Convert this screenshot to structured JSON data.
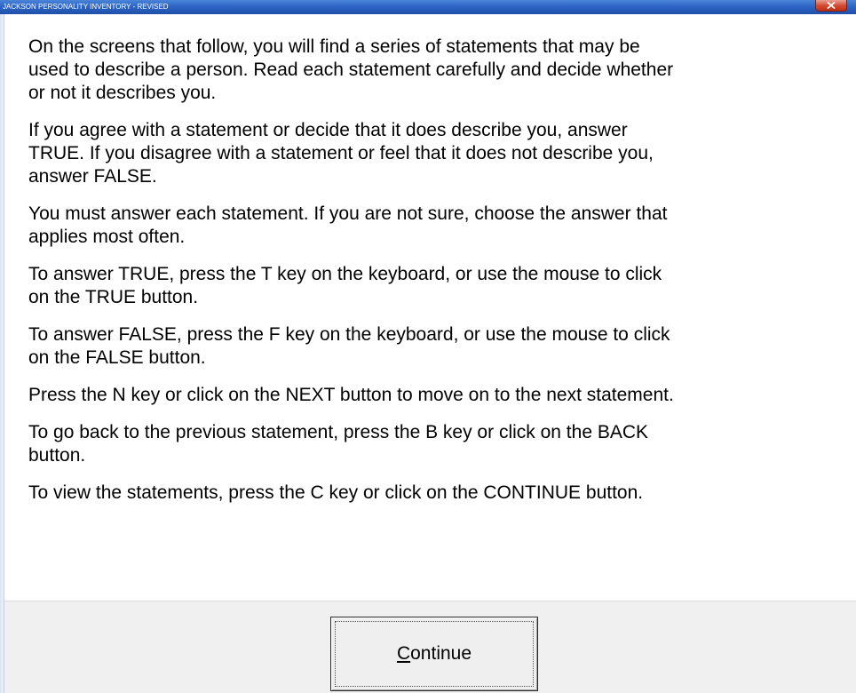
{
  "window": {
    "title": "JACKSON PERSONALITY INVENTORY - REVISED",
    "close_icon": "close-x-icon"
  },
  "instructions": [
    "On the screens that follow, you will find a series of statements that may be\nused to describe a person. Read each statement carefully and decide whether\nor not it describes you.",
    "If you agree with a statement or decide that it does describe you, answer\nTRUE. If you disagree with a statement or feel that it does not describe you,\nanswer FALSE.",
    "You must answer each statement. If you are not sure, choose the answer that\napplies most often.",
    "To answer TRUE, press the T key on the keyboard, or use the mouse to click\non the TRUE button.",
    "To answer FALSE, press the F key on the keyboard, or use the mouse to click\non the FALSE button.",
    "Press the N key or click on the NEXT button to move on to the next statement.",
    "To go back to the previous statement, press the B key or click on the BACK\nbutton.",
    "To view the statements, press the C key or click on the CONTINUE button."
  ],
  "continue_button": {
    "mnemonic": "C",
    "rest": "ontinue"
  },
  "colors": {
    "titlebar": "#2c63c2",
    "close_button": "#d2482f",
    "footer": "#f0f0f0"
  }
}
